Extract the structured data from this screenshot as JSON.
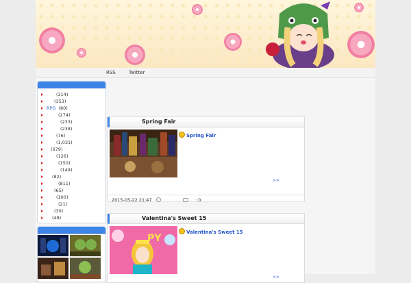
{
  "nav": {
    "rss": "RSS",
    "twitter": "Twitter"
  },
  "categories": [
    {
      "name": "",
      "count": "(314)"
    },
    {
      "name": "",
      "count": "(353)"
    },
    {
      "name": "RPG",
      "count": "(80)"
    },
    {
      "name": "",
      "count": "(274)"
    },
    {
      "name": "",
      "count": "(233)"
    },
    {
      "name": "",
      "count": "(238)"
    },
    {
      "name": "",
      "count": "(76)"
    },
    {
      "name": "",
      "count": "(1,031)"
    },
    {
      "name": "",
      "count": "(679)"
    },
    {
      "name": "",
      "count": "(126)"
    },
    {
      "name": "",
      "count": "(150)"
    },
    {
      "name": "",
      "count": "(149)"
    },
    {
      "name": "",
      "count": "(82)"
    },
    {
      "name": "",
      "count": "(811)"
    },
    {
      "name": "",
      "count": "(65)"
    },
    {
      "name": "",
      "count": "(100)"
    },
    {
      "name": "",
      "count": "(21)"
    },
    {
      "name": "",
      "count": "(30)"
    },
    {
      "name": "",
      "count": "(48)"
    }
  ],
  "posts": [
    {
      "title": "Spring Fair",
      "link": "Spring Fair",
      "more": ">>",
      "date": "2015-05-22 21:47",
      "comments": ": 0"
    },
    {
      "title": "Valentina's Sweet 15",
      "link": "Valentina's Sweet 15",
      "more": ">>"
    }
  ],
  "colors": {
    "accent": "#3d84e8",
    "link": "#2255cc",
    "arrow": "#dd3333"
  }
}
